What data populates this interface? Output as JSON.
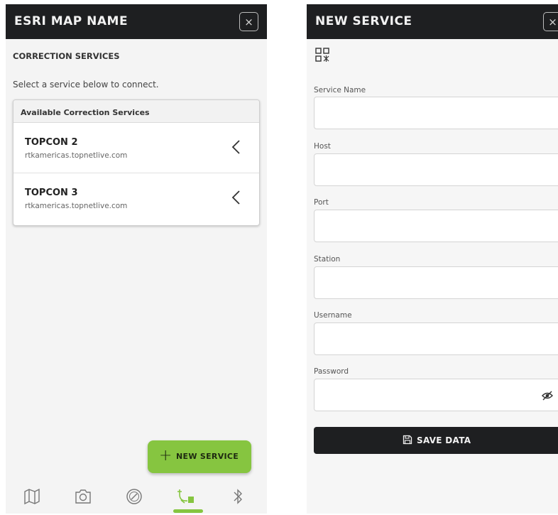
{
  "left": {
    "header": {
      "title": "ESRI MAP NAME",
      "close_label": "×"
    },
    "section_title": "CORRECTION SERVICES",
    "instruction": "Select a service below to connect.",
    "list_header": "Available Correction Services",
    "services": [
      {
        "name": "TOPCON 2",
        "host": "rtkamericas.topnetlive.com"
      },
      {
        "name": "TOPCON 3",
        "host": "rtkamericas.topnetlive.com"
      }
    ],
    "fab": {
      "plus": "+",
      "label": "NEW SERVICE"
    },
    "nav": [
      "map-icon",
      "camera-icon",
      "compass-icon",
      "correction-services-icon",
      "bluetooth-icon"
    ],
    "nav_active": 3
  },
  "right": {
    "header": {
      "title": "NEW SERVICE",
      "close_label": "×"
    },
    "fields": [
      {
        "label": "Service Name",
        "value": ""
      },
      {
        "label": "Host",
        "value": ""
      },
      {
        "label": "Port",
        "value": ""
      },
      {
        "label": "Station",
        "value": ""
      },
      {
        "label": "Username",
        "value": ""
      },
      {
        "label": "Password",
        "value": ""
      }
    ],
    "save_label": "SAVE DATA"
  },
  "colors": {
    "header_bg": "#1e1f21",
    "accent_green": "#86c540",
    "panel_bg": "#f4f4f4"
  }
}
